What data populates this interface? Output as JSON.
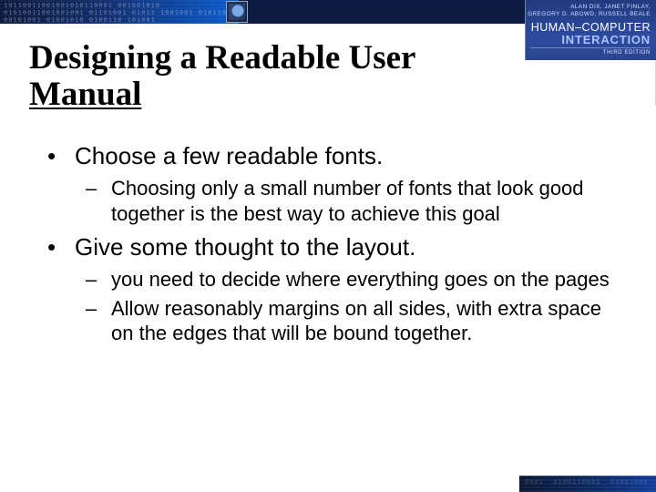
{
  "book": {
    "authors_line1": "ALAN DIX, JANET FINLAY,",
    "authors_line2": "GREGORY D. ABOWD, RUSSELL BEALE",
    "title_line1": "HUMAN–COMPUTER",
    "title_line2": "INTERACTION",
    "edition": "THIRD EDITION"
  },
  "heading": {
    "line1": "Designing a Readable User",
    "line2_underlined": "Manual"
  },
  "bullets": [
    {
      "text": "Choose a few readable fonts.",
      "sub": [
        " Choosing only a small number of fonts that look good together is the best way to achieve this goal"
      ]
    },
    {
      "text": "Give some thought to the layout.",
      "sub": [
        "you need to decide where everything goes on the pages",
        "Allow reasonably margins on all sides, with extra space on the edges that will be bound together."
      ]
    }
  ]
}
